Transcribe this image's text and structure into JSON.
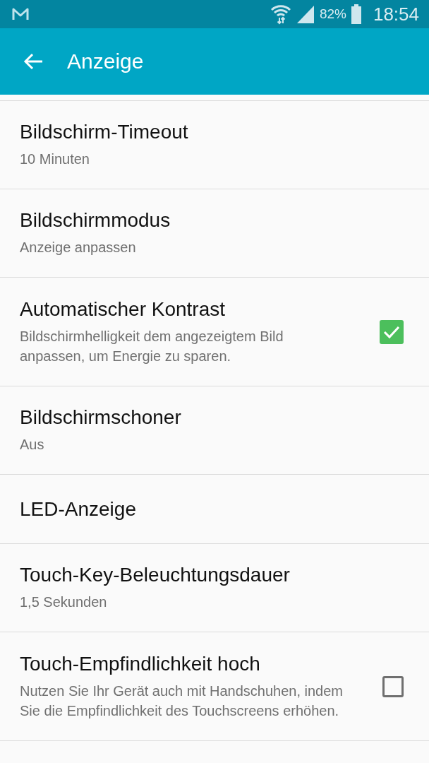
{
  "status_bar": {
    "battery_text": "82%",
    "time": "18:54"
  },
  "app_bar": {
    "title": "Anzeige"
  },
  "settings": [
    {
      "kind": "text",
      "title": "Bildschirm-Timeout",
      "summary": "10 Minuten"
    },
    {
      "kind": "text",
      "title": "Bildschirmmodus",
      "summary": "Anzeige anpassen"
    },
    {
      "kind": "checkbox",
      "title": "Automatischer Kontrast",
      "summary": "Bildschirmhelligkeit dem angezeigtem Bild anpassen, um Energie zu sparen.",
      "checked": true
    },
    {
      "kind": "text",
      "title": "Bildschirmschoner",
      "summary": "Aus"
    },
    {
      "kind": "text",
      "title": "LED-Anzeige"
    },
    {
      "kind": "text",
      "title": "Touch-Key-Beleuchtungsdauer",
      "summary": "1,5 Sekunden"
    },
    {
      "kind": "checkbox",
      "title": "Touch-Empfindlichkeit hoch",
      "summary": "Nutzen Sie Ihr Gerät auch mit Handschuhen, indem Sie die Empfindlichkeit des Touchscreens erhöhen.",
      "checked": false
    }
  ]
}
